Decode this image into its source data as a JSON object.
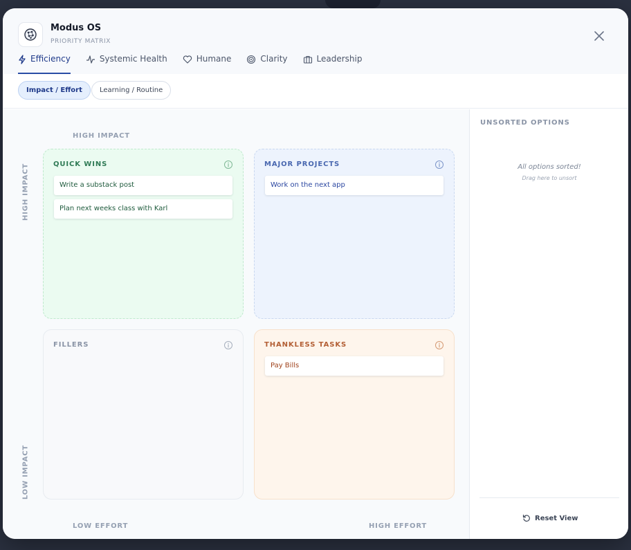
{
  "app": {
    "title": "Modus OS",
    "subtitle": "PRIORITY MATRIX"
  },
  "tabs": [
    {
      "label": "Efficiency",
      "icon": "bolt-icon",
      "active": true
    },
    {
      "label": "Systemic Health",
      "icon": "pulse-icon",
      "active": false
    },
    {
      "label": "Humane",
      "icon": "heart-icon",
      "active": false
    },
    {
      "label": "Clarity",
      "icon": "target-icon",
      "active": false
    },
    {
      "label": "Leadership",
      "icon": "briefcase-icon",
      "active": false
    }
  ],
  "views": [
    {
      "label": "Impact / Effort",
      "active": true
    },
    {
      "label": "Learning / Routine",
      "active": false
    }
  ],
  "axes": {
    "top": "HIGH IMPACT",
    "left_top": "HIGH IMPACT",
    "left_bottom": "LOW IMPACT",
    "bottom_left": "LOW EFFORT",
    "bottom_right": "HIGH EFFORT"
  },
  "quadrants": {
    "quick_wins": {
      "title": "QUICK WINS",
      "color": "#2f7a55",
      "items": [
        "Write a substack post",
        "Plan next weeks class with Karl"
      ]
    },
    "major_projects": {
      "title": "MAJOR PROJECTS",
      "color": "#4a68b0",
      "items": [
        "Work on the next app"
      ]
    },
    "fillers": {
      "title": "FILLERS",
      "color": "#8a94a6",
      "items": []
    },
    "thankless_tasks": {
      "title": "THANKLESS TASKS",
      "color": "#b35f35",
      "items": [
        "Pay Bills"
      ]
    }
  },
  "sidebar": {
    "title": "UNSORTED OPTIONS",
    "empty_message": "All options sorted!",
    "empty_hint": "Drag here to unsort",
    "reset_label": "Reset View"
  },
  "colors": {
    "accent": "#1f3a8a",
    "quick_wins_bg": "#ebfbf1",
    "major_projects_bg": "#edf3fd",
    "fillers_bg": "#f8f9fb",
    "thankless_bg": "#fef5ec"
  }
}
